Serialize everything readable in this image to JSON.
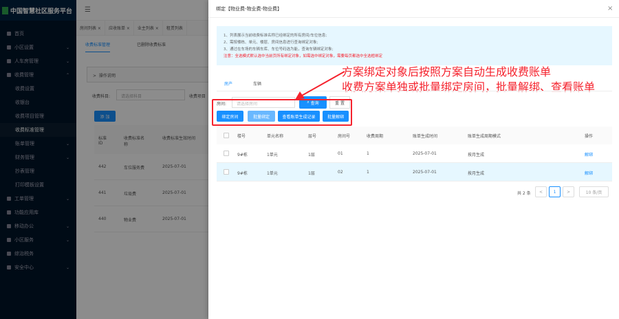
{
  "app": {
    "title": "中国智慧社区服务平台"
  },
  "sidebar": {
    "items": [
      {
        "label": "首页",
        "icon": "home-icon"
      },
      {
        "label": "小区设置",
        "icon": "settings-icon",
        "chev": "⌄"
      },
      {
        "label": "人车房管理",
        "icon": "building-icon",
        "chev": "⌄"
      },
      {
        "label": "收费管理",
        "icon": "money-bag-icon",
        "chev": "⌃"
      },
      {
        "label": "收费设置",
        "sub": true
      },
      {
        "label": "收银台",
        "sub": true
      },
      {
        "label": "收费项目管理",
        "sub": true
      },
      {
        "label": "收费标准管理",
        "sub": true,
        "active": true
      },
      {
        "label": "账单管理",
        "sub": true,
        "chev": "⌄"
      },
      {
        "label": "财务管理",
        "sub": true,
        "chev": "⌄"
      },
      {
        "label": "抄表管理",
        "sub": true
      },
      {
        "label": "打印模板设置",
        "sub": true
      },
      {
        "label": "工单管理",
        "icon": "ticket-icon",
        "chev": "⌄"
      },
      {
        "label": "功能应用库",
        "icon": "apps-icon"
      },
      {
        "label": "移动办公",
        "icon": "briefcase-icon",
        "chev": "⌄"
      },
      {
        "label": "小区服务",
        "icon": "service-icon",
        "chev": "⌄"
      },
      {
        "label": "综治税务",
        "icon": "bank-icon"
      },
      {
        "label": "安全中心",
        "icon": "shield-icon",
        "chev": "⌄"
      }
    ]
  },
  "main": {
    "page_tabs": [
      "房间列表 ×",
      "应收账单 ×",
      "业主列表 ×",
      "租赁列表"
    ],
    "sub_tabs": [
      "收费标准管理",
      "已删除收费标准"
    ],
    "collapse": "操作说明",
    "filter_label": "收费科目:",
    "filter_placeholder": "请选择科目",
    "filter2_label": "收费项目",
    "add_button": "添 加",
    "table_headers": [
      "标准ID",
      "收费标准名称",
      "收费标准生效时间"
    ],
    "rows": [
      [
        "442",
        "车位服务费",
        "2025-07-01"
      ],
      [
        "441",
        "垃圾费",
        "2025-07-01"
      ],
      [
        "440",
        "物业费",
        "2025-07-01"
      ]
    ]
  },
  "drawer": {
    "title": "绑定【物业费-物业费-物业费】",
    "close": "×",
    "info": [
      "1、列表展示当前收费标准名称已经绑定的所有房间/车位信息;",
      "2、需按楼栋、单元、楼层、房间信息进行查询绑定对象;",
      "3、通过在车场的车辆车库、车位号码选为能，查询车辆绑定对象;"
    ],
    "warning": "注意：全选模式默认选中当前页所有绑定对象，如需选中绑定对象，需要每页都选中全选框绑定",
    "tabs": [
      "房产",
      "车辆"
    ],
    "search_label": "房间:",
    "search_placeholder": "请选择房间",
    "search_button": "查询",
    "reset_button": "重 置",
    "actions": [
      "绑定房间",
      "批量绑定",
      "查看账单生成记录",
      "批量解绑"
    ],
    "columns": [
      "楼号",
      "单元名称",
      "层号",
      "房间号",
      "收费周期",
      "账单生成时间",
      "账单生成周期模式",
      "操作"
    ],
    "rows": [
      [
        "9#栋",
        "1单元",
        "1层",
        "01",
        "1",
        "2025-07-01",
        "按月生成",
        "解绑"
      ],
      [
        "9#栋",
        "1单元",
        "1层",
        "02",
        "1",
        "2025-07-01",
        "按月生成",
        "解绑"
      ]
    ],
    "pagination": {
      "total": "共 2 条",
      "current": "1",
      "page_size": "10 条/页",
      "prev": "<",
      "next": ">"
    }
  },
  "annotation": {
    "line1": "方案绑定对象后按照方案自动生成收费账单",
    "line2": "收费方案单独或批量绑定房间，批量解绑、查看账单"
  },
  "colors": {
    "primary": "#1890ff",
    "annotation": "#f5222d",
    "sidebar": "#001529"
  }
}
